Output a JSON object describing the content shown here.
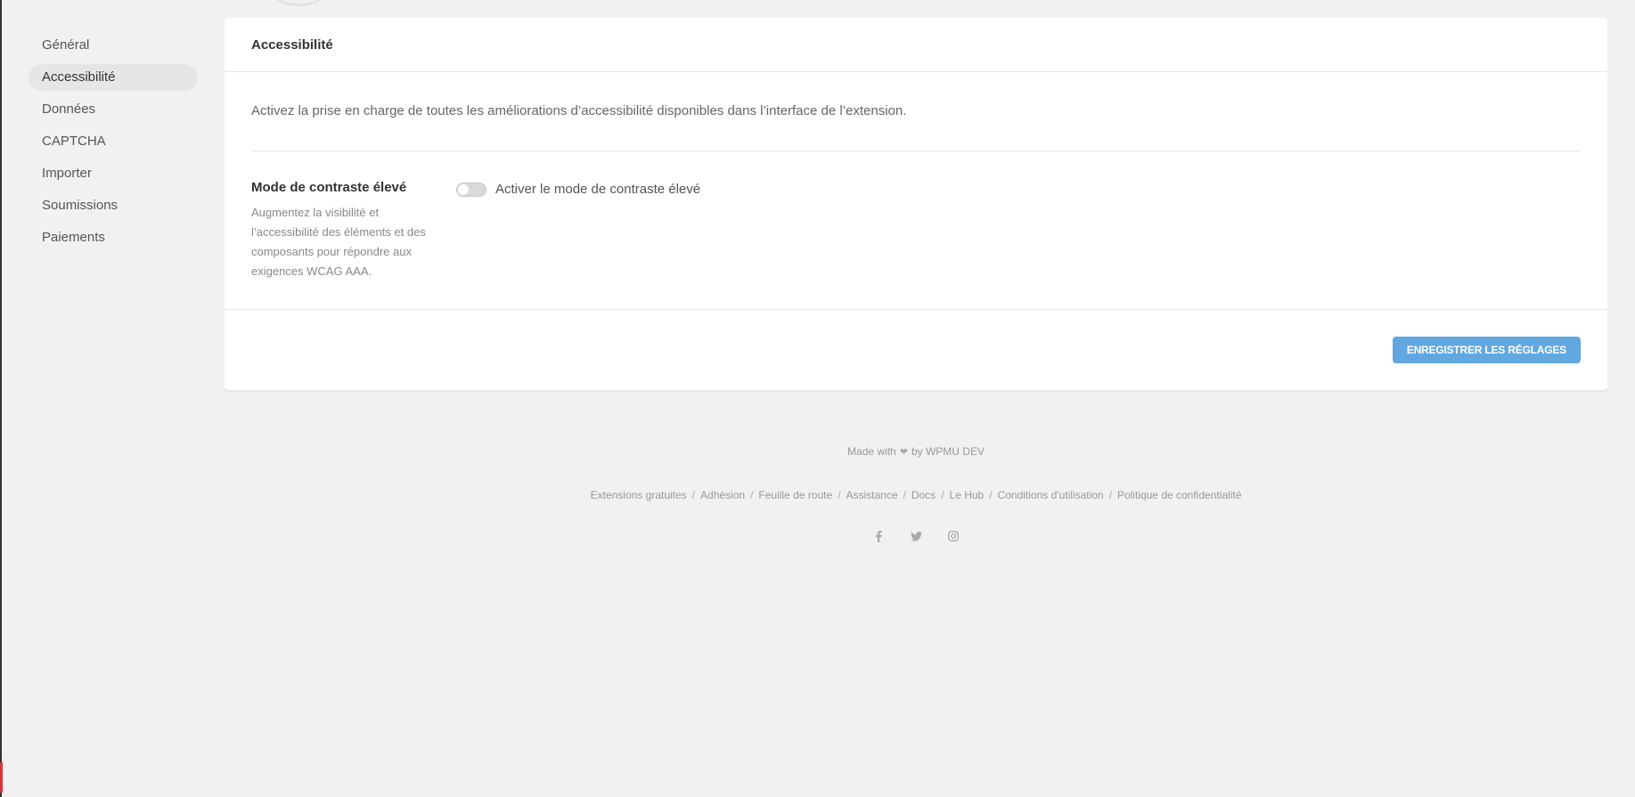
{
  "sidebar": {
    "items": [
      {
        "label": "Général"
      },
      {
        "label": "Accessibilité",
        "active": true
      },
      {
        "label": "Données"
      },
      {
        "label": "CAPTCHA"
      },
      {
        "label": "Importer"
      },
      {
        "label": "Soumissions"
      },
      {
        "label": "Paiements"
      }
    ]
  },
  "box": {
    "title": "Accessibilité",
    "intro": "Activez la prise en charge de toutes les améliorations d’accessibilité disponibles dans l’interface de l’extension.",
    "setting": {
      "title": "Mode de contraste élevé",
      "description": "Augmentez la visibilité et l’accessibilité des éléments et des composants pour répondre aux exigences WCAG AAA.",
      "toggle_label": "Activer le mode de contraste élevé",
      "enabled": false
    },
    "save_label": "ENREGISTRER LES RÉGLAGES"
  },
  "footer": {
    "made_with": "Made with",
    "by": "by WPMU DEV",
    "links": [
      "Extensions gratuites",
      "Adhésion",
      "Feuille de route",
      "Assistance",
      "Docs",
      "Le Hub",
      "Conditions d'utilisation",
      "Politique de confidentialité"
    ],
    "social_icons": [
      "facebook-icon",
      "twitter-icon",
      "instagram-icon"
    ]
  },
  "colors": {
    "accent": "#62a8e0",
    "background": "#f1f1f1",
    "panel": "#ffffff"
  }
}
